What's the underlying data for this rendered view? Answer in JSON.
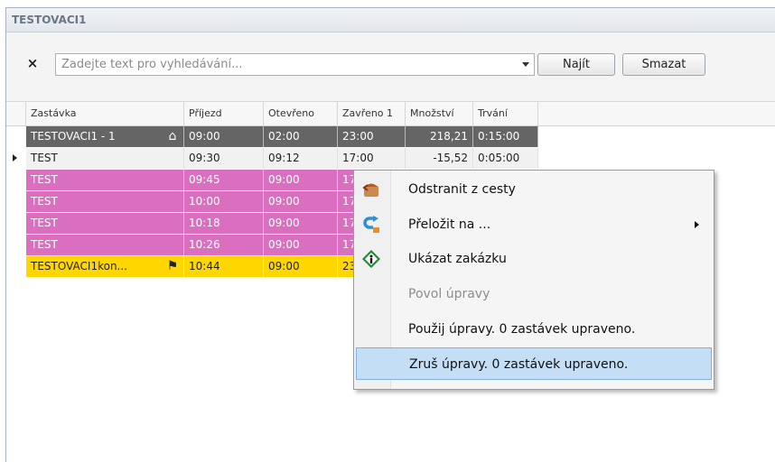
{
  "panel": {
    "title": "TESTOVACI1"
  },
  "search": {
    "clear_icon": "×",
    "placeholder": "Zadejte text pro vyhledávání...",
    "value": "",
    "find_label": "Najít",
    "clear_label": "Smazat"
  },
  "grid": {
    "columns": [
      "Zastávka",
      "Příjezd",
      "Otevřeno",
      "Zavřeno 1",
      "Množství",
      "Trvání"
    ],
    "rows": [
      {
        "stop": "TESTOVACI1 - 1",
        "arrival": "09:00",
        "open": "02:00",
        "close": "23:00",
        "amount": "218,21",
        "duration": "0:15:00",
        "style": "depot",
        "icon": "house-icon"
      },
      {
        "stop": "TEST",
        "arrival": "09:30",
        "open": "09:12",
        "close": "17:00",
        "amount": "-15,52",
        "duration": "0:05:00",
        "style": "current",
        "icon": ""
      },
      {
        "stop": "TEST",
        "arrival": "09:45",
        "open": "09:00",
        "close": "17",
        "amount": "",
        "duration": "",
        "style": "pink",
        "icon": ""
      },
      {
        "stop": "TEST",
        "arrival": "10:00",
        "open": "09:00",
        "close": "17",
        "amount": "",
        "duration": "",
        "style": "pink",
        "icon": ""
      },
      {
        "stop": "TEST",
        "arrival": "10:18",
        "open": "09:00",
        "close": "17",
        "amount": "",
        "duration": "",
        "style": "pink",
        "icon": ""
      },
      {
        "stop": "TEST",
        "arrival": "10:26",
        "open": "09:00",
        "close": "17",
        "amount": "",
        "duration": "",
        "style": "pink",
        "icon": ""
      },
      {
        "stop": "TESTOVACI1kon...",
        "arrival": "10:44",
        "open": "09:00",
        "close": "23",
        "amount": "",
        "duration": "",
        "style": "yellow",
        "icon": "finish-flag-icon"
      }
    ]
  },
  "context_menu": {
    "items": [
      {
        "label": "Odstranit z cesty",
        "icon": "remove-from-route-icon",
        "enabled": true,
        "submenu": false,
        "hover": false
      },
      {
        "label": "Přeložit na ...",
        "icon": "move-arrow-icon",
        "enabled": true,
        "submenu": true,
        "hover": false
      },
      {
        "label": "Ukázat zakázku",
        "icon": "info-icon",
        "enabled": true,
        "submenu": false,
        "hover": false
      },
      {
        "label": "Povol úpravy",
        "icon": "",
        "enabled": false,
        "submenu": false,
        "hover": false
      },
      {
        "label": "Použij úpravy. 0 zastávek upraveno.",
        "icon": "",
        "enabled": true,
        "submenu": false,
        "hover": false
      },
      {
        "label": "Zruš úpravy. 0 zastávek upraveno.",
        "icon": "",
        "enabled": true,
        "submenu": false,
        "hover": true
      }
    ]
  },
  "colors": {
    "depot_row": "#656565",
    "pink_row": "#db6fbf",
    "yellow_row": "#ffd700",
    "menu_hover": "#c4def5"
  }
}
